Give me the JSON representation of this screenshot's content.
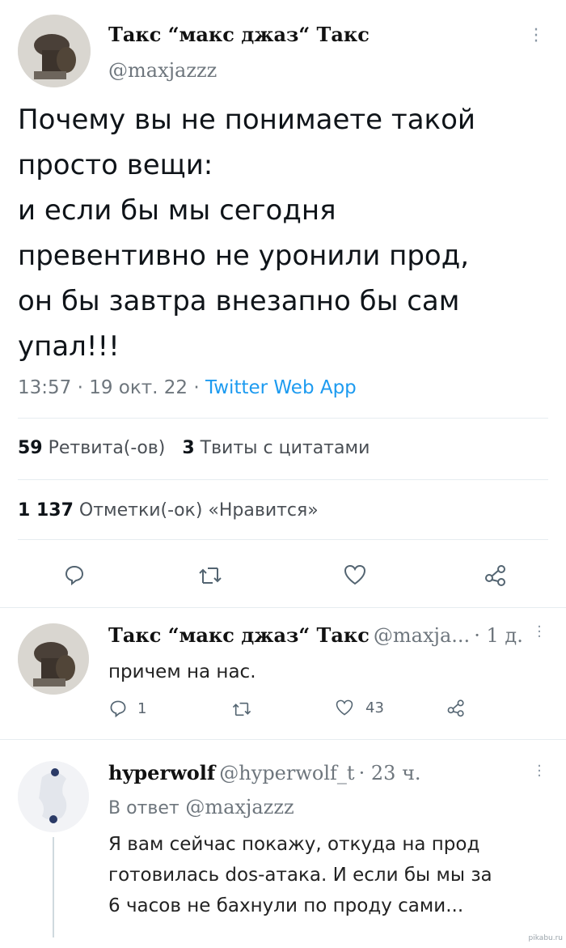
{
  "main_tweet": {
    "author_name": "Такс “макс джаз“ Такс",
    "author_handle": "@maxjazzz",
    "lines": [
      "Почему вы не понимаете такой",
      "просто вещи:",
      "и если бы мы сегодня",
      "превентивно не уронили прод,",
      "он бы завтра внезапно бы сам",
      "упал!!!"
    ],
    "time": "13:57",
    "date": "19 окт. 22",
    "source": "Twitter Web App",
    "separator": "·",
    "retweets_count": "59",
    "retweets_label": "Ретвита(-ов)",
    "quotes_count": "3",
    "quotes_label": "Твиты с цитатами",
    "likes_count": "1 137",
    "likes_label": "Отметки(-ок) «Нравится»"
  },
  "reply_1": {
    "author_name": "Такс “макс джаз“ Такс",
    "author_handle": "@maxja...",
    "age": "· 1 д.",
    "text": "причем на нас.",
    "reply_count": "1",
    "like_count": "43"
  },
  "reply_2": {
    "author_name": "hyperwolf",
    "author_handle": "@hyperwolf_t",
    "age": "· 23 ч.",
    "in_reply_prefix": "В ответ",
    "in_reply_handle": "@maxjazzz",
    "lines": [
      "Я вам сейчас покажу, откуда на прод",
      "готовилась dos-атака. И если бы мы за",
      "6 часов не бахнули по проду сами..."
    ]
  },
  "watermark": "pikabu.ru",
  "colors": {
    "link": "#1d9bf0",
    "muted": "#6e767d",
    "divider": "#e6ecf0",
    "text": "#0f1419"
  },
  "icons": [
    "more-icon",
    "reply-icon",
    "retweet-icon",
    "like-icon",
    "share-icon"
  ]
}
